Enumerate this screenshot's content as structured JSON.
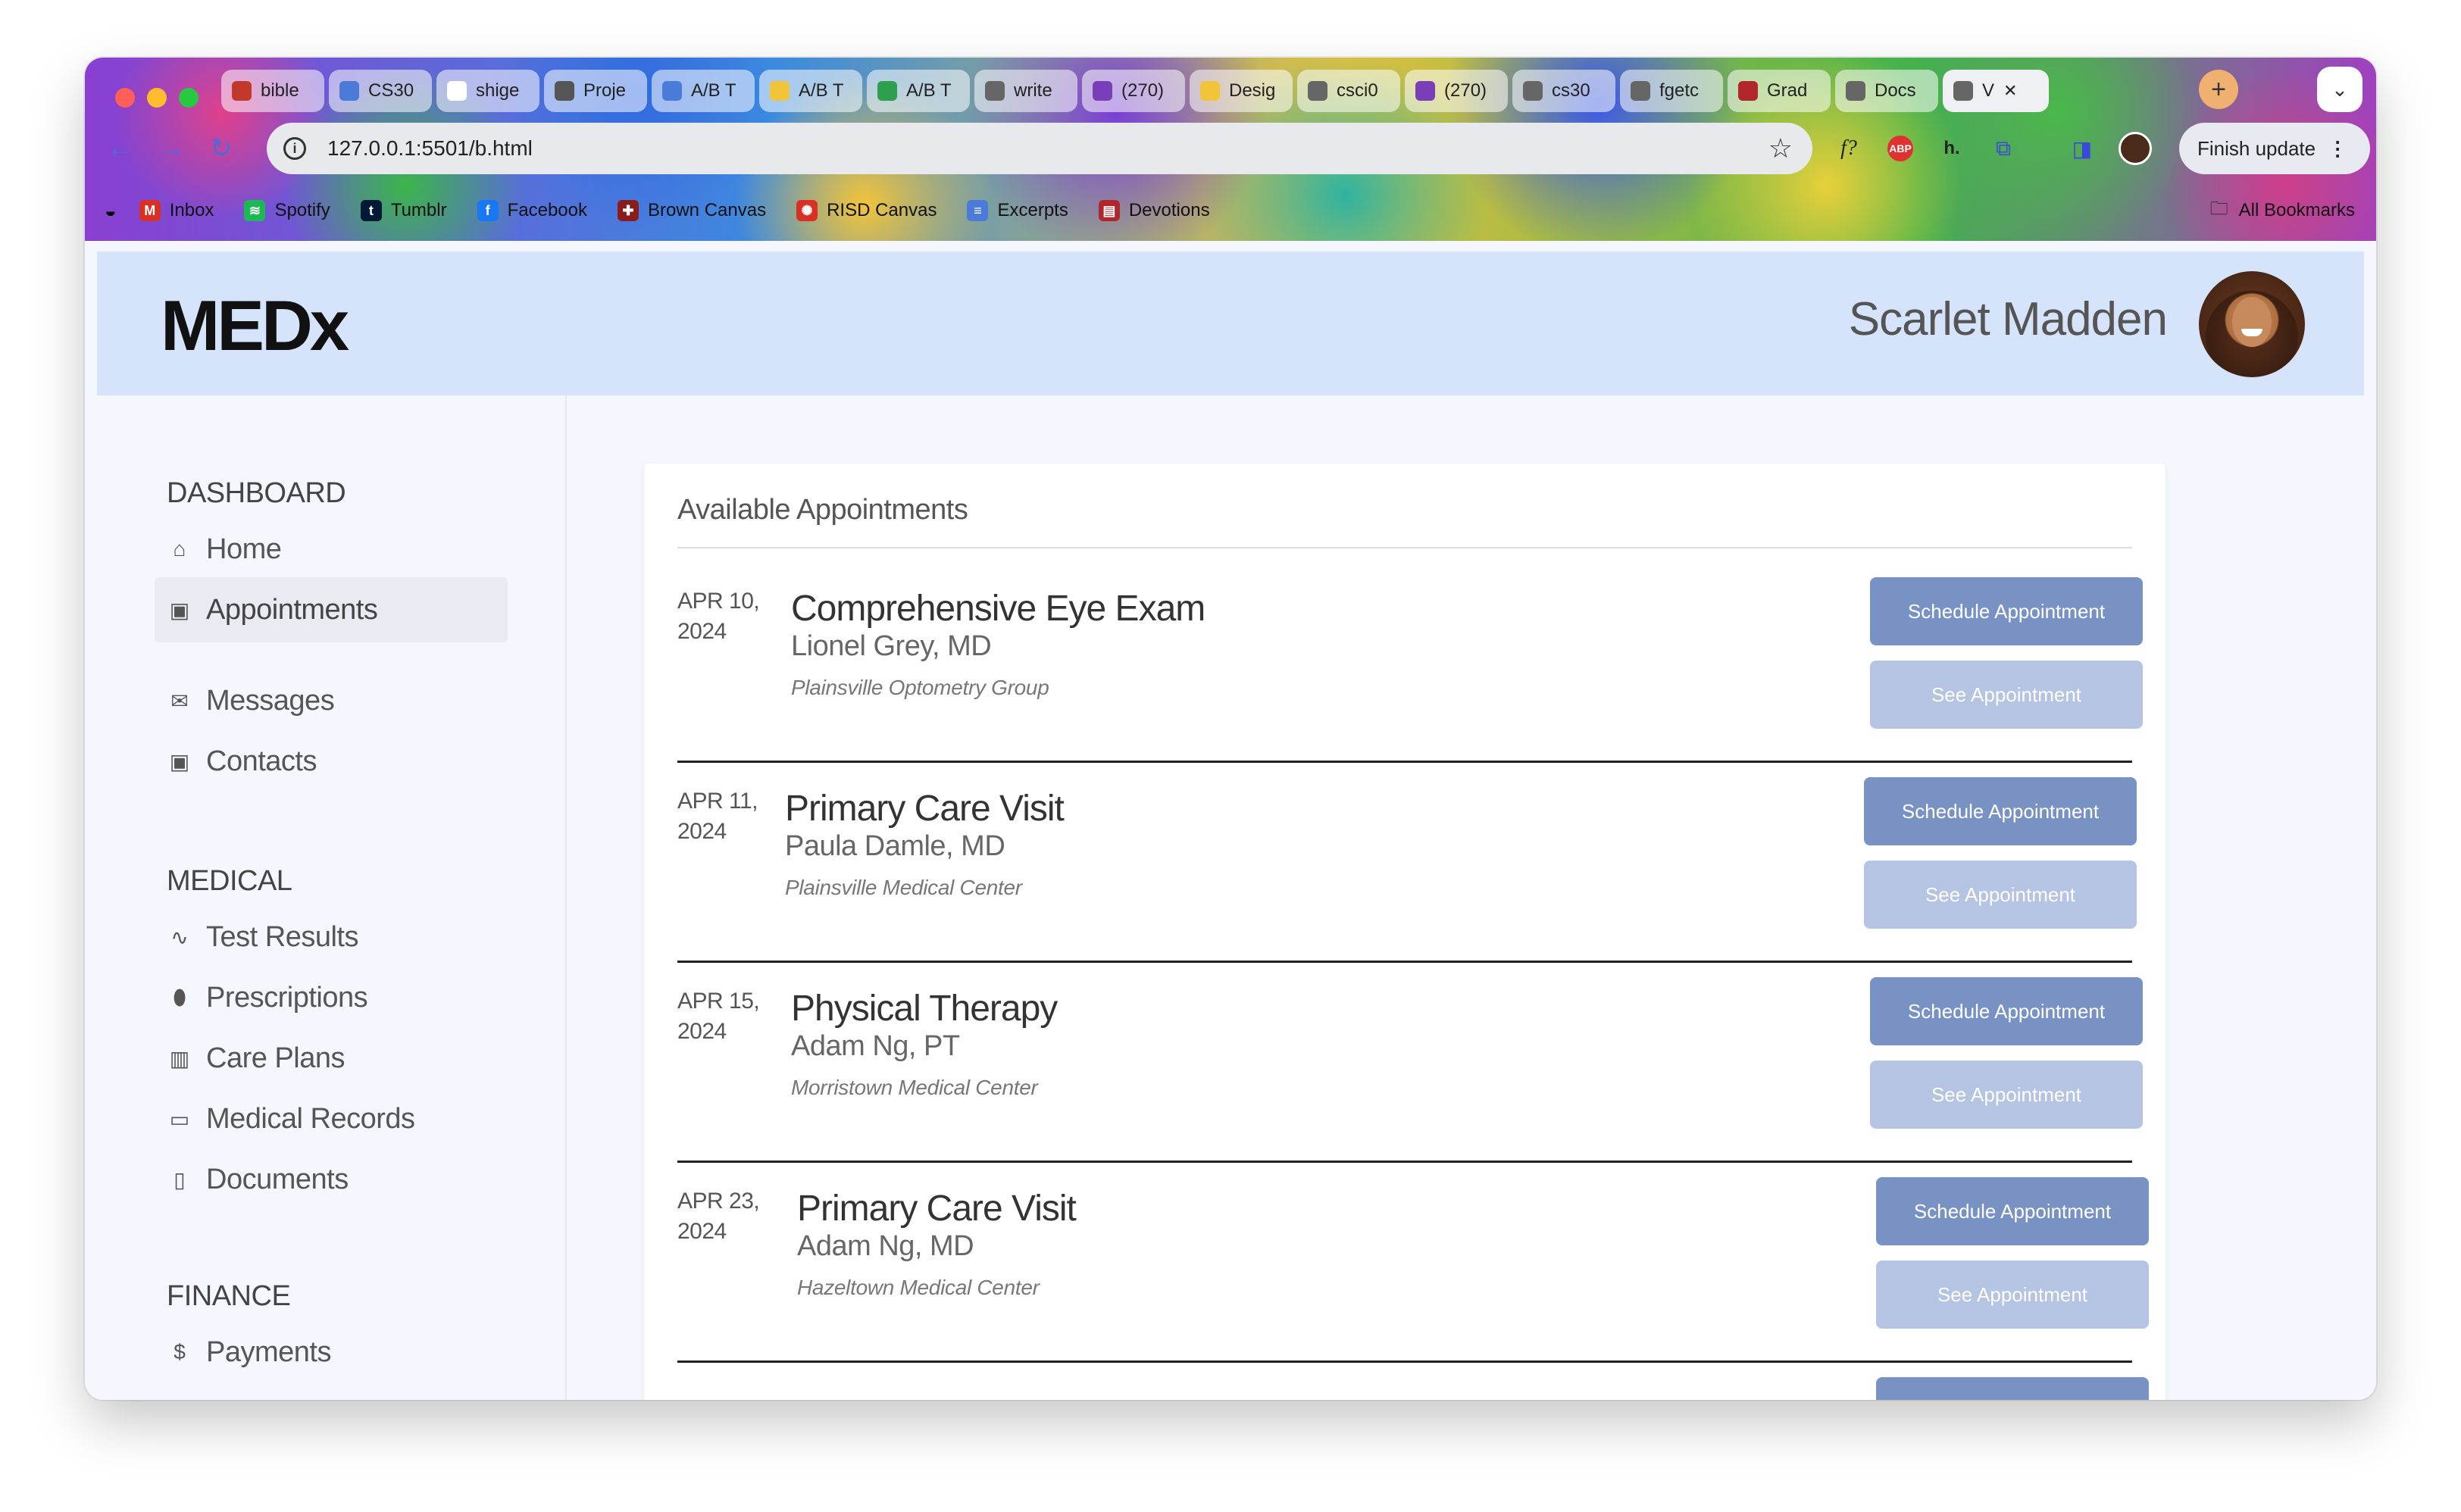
{
  "browser": {
    "tabs": [
      {
        "label": "bible",
        "color": "#c0392b"
      },
      {
        "label": "CS30",
        "color": "#4a7bd8"
      },
      {
        "label": "shige",
        "color": "#ffffff"
      },
      {
        "label": "Proje",
        "color": "#555555"
      },
      {
        "label": "A/B T",
        "color": "#4a7bd8"
      },
      {
        "label": "A/B T",
        "color": "#f2c43a"
      },
      {
        "label": "A/B T",
        "color": "#2e9e4f"
      },
      {
        "label": "write",
        "color": "#666666"
      },
      {
        "label": "(270)",
        "color": "#7a3fb8"
      },
      {
        "label": "Desig",
        "color": "#f2c43a"
      },
      {
        "label": "csci0",
        "color": "#666666"
      },
      {
        "label": "(270)",
        "color": "#7a3fb8"
      },
      {
        "label": "cs30",
        "color": "#666666"
      },
      {
        "label": "fgetc",
        "color": "#666666"
      },
      {
        "label": "Grad",
        "color": "#b0262c"
      },
      {
        "label": "Docs",
        "color": "#666666"
      },
      {
        "label": "V",
        "color": "#666666",
        "active": true
      }
    ],
    "tab_close": "✕",
    "new_tab": "+",
    "url": "127.0.0.1:5501/b.html",
    "finish_update": "Finish update",
    "bookmarks": [
      {
        "label": "Inbox",
        "color": "#d93025",
        "glyph": "M"
      },
      {
        "label": "Spotify",
        "color": "#1db954",
        "glyph": "≋"
      },
      {
        "label": "Tumblr",
        "color": "#001935",
        "glyph": "t"
      },
      {
        "label": "Facebook",
        "color": "#1877f2",
        "glyph": "f"
      },
      {
        "label": "Brown Canvas",
        "color": "#8a1c1c",
        "glyph": "✚"
      },
      {
        "label": "RISD Canvas",
        "color": "#d93025",
        "glyph": "✺"
      },
      {
        "label": "Excerpts",
        "color": "#4a7bd8",
        "glyph": "≡"
      },
      {
        "label": "Devotions",
        "color": "#b0262c",
        "glyph": "▤"
      }
    ],
    "all_bookmarks": "All Bookmarks"
  },
  "header": {
    "logo": "MEDx",
    "user_name": "Scarlet Madden"
  },
  "sidebar": {
    "sections": [
      {
        "title": "DASHBOARD",
        "items": [
          {
            "label": "Home",
            "icon": "home-icon",
            "glyph": "⌂"
          },
          {
            "label": "Appointments",
            "icon": "calendar-icon",
            "glyph": "▣",
            "active": true
          },
          {
            "label": "Messages",
            "icon": "mail-icon",
            "glyph": "✉"
          },
          {
            "label": "Contacts",
            "icon": "contact-card-icon",
            "glyph": "▣"
          }
        ]
      },
      {
        "title": "MEDICAL",
        "items": [
          {
            "label": "Test Results",
            "icon": "pulse-icon",
            "glyph": "∿"
          },
          {
            "label": "Prescriptions",
            "icon": "pill-icon",
            "glyph": "⬮"
          },
          {
            "label": "Care Plans",
            "icon": "building-icon",
            "glyph": "▥"
          },
          {
            "label": "Medical Records",
            "icon": "folder-icon",
            "glyph": "▭"
          },
          {
            "label": "Documents",
            "icon": "document-icon",
            "glyph": "▯"
          }
        ]
      },
      {
        "title": "FINANCE",
        "items": [
          {
            "label": "Payments",
            "icon": "dollar-coin-icon",
            "glyph": "$"
          }
        ]
      }
    ]
  },
  "main": {
    "card_title": "Available Appointments",
    "schedule_label": "Schedule Appointment",
    "see_label": "See Appointment",
    "appointments": [
      {
        "date_line1": "APR 10,",
        "date_line2": "2024",
        "type": "Comprehensive Eye Exam",
        "doctor": "Lionel Grey, MD",
        "location": "Plainsville Optometry Group"
      },
      {
        "date_line1": "APR 11,",
        "date_line2": "2024",
        "type": "Primary Care Visit",
        "doctor": "Paula Damle, MD",
        "location": "Plainsville Medical Center"
      },
      {
        "date_line1": "APR 15,",
        "date_line2": "2024",
        "type": "Physical Therapy",
        "doctor": "Adam Ng, PT",
        "location": "Morristown Medical Center"
      },
      {
        "date_line1": "APR 23,",
        "date_line2": "2024",
        "type": "Primary Care Visit",
        "doctor": "Adam Ng, MD",
        "location": "Hazeltown Medical Center"
      }
    ]
  }
}
